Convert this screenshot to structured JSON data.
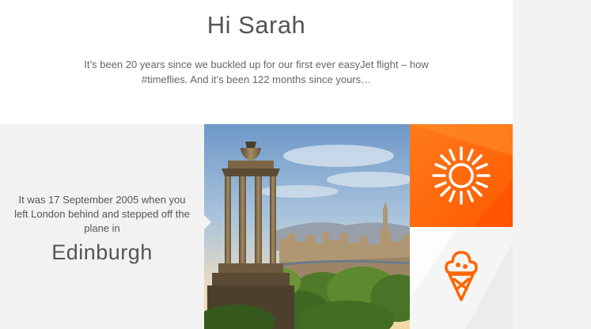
{
  "header": {
    "greeting": "Hi Sarah",
    "intro_line1": "It’s been 20 years since we buckled up for our first ever easyJet flight – how",
    "intro_line2": "#timeflies. And it’s been 122 months since yours…"
  },
  "story": {
    "line1": "It was 17 September 2005 when you",
    "line2": "left London behind and stepped off the",
    "line3": "plane in",
    "city": "Edinburgh"
  },
  "tiles": {
    "sun_icon": "sun-icon",
    "ice_cream_icon": "ice-cream-icon"
  },
  "colors": {
    "brand_orange": "#ff6600",
    "panel_grey": "#f2f2f2",
    "text_grey": "#555555"
  }
}
